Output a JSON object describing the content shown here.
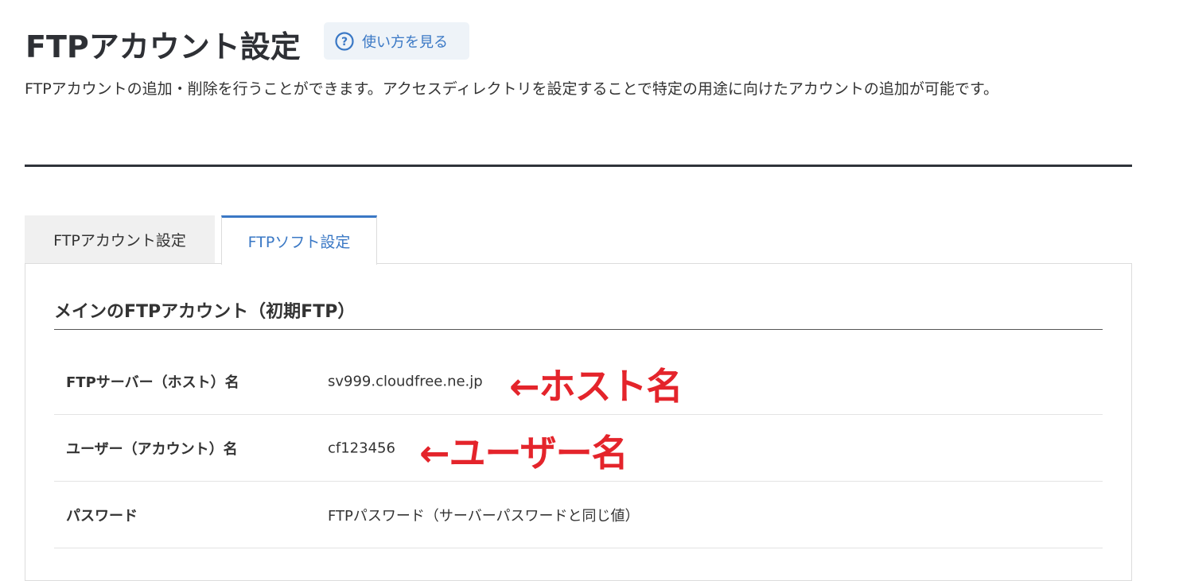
{
  "header": {
    "title": "FTPアカウント設定",
    "help_button_label": "使い方を見る",
    "description": "FTPアカウントの追加・削除を行うことができます。アクセスディレクトリを設定することで特定の用途に向けたアカウントの追加が可能です。"
  },
  "tabs": [
    {
      "label": "FTPアカウント設定",
      "active": false
    },
    {
      "label": "FTPソフト設定",
      "active": true
    }
  ],
  "panel": {
    "heading": "メインのFTPアカウント（初期FTP）",
    "rows": [
      {
        "label": "FTPサーバー（ホスト）名",
        "value": "sv999.cloudfree.ne.jp",
        "annotation": "←ホスト名"
      },
      {
        "label": "ユーザー（アカウント）名",
        "value": "cf123456",
        "annotation": "←ユーザー名"
      },
      {
        "label": "パスワード",
        "value": "FTPパスワード（サーバーパスワードと同じ値）"
      }
    ]
  },
  "colors": {
    "accent": "#3a78c5",
    "annotation": "#e4242b",
    "title": "#2e3035"
  },
  "icons": {
    "help": "question-circle-icon"
  }
}
